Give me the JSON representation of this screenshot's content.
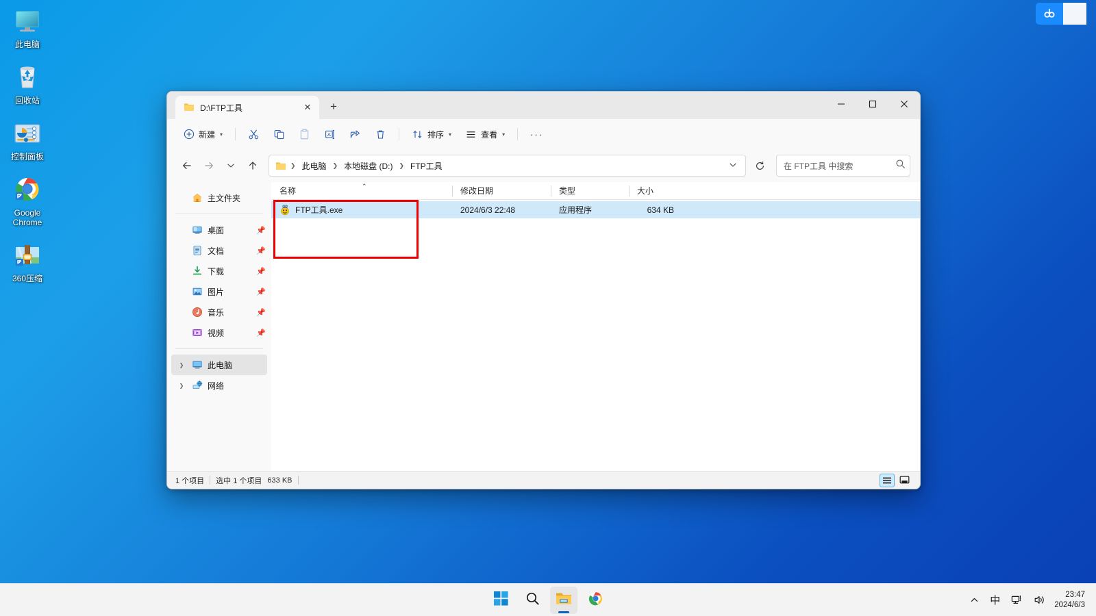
{
  "desktop": {
    "icons": [
      {
        "label": "此电脑",
        "icon": "this-pc-icon"
      },
      {
        "label": "回收站",
        "icon": "recycle-bin-icon"
      },
      {
        "label": "控制面板",
        "icon": "control-panel-icon"
      },
      {
        "label": "Google Chrome",
        "icon": "chrome-icon"
      },
      {
        "label": "360压缩",
        "icon": "360-zip-icon"
      }
    ]
  },
  "netdisk_widget": {
    "icon": "baidu-netdisk-icon",
    "accent": "#1a8cff"
  },
  "explorer": {
    "tab": {
      "title": "D:\\FTP工具",
      "icon": "folder-icon",
      "close_label": "✕"
    },
    "new_tab_label": "+",
    "window_controls": {
      "minimize": "—",
      "maximize": "▢",
      "close": "✕"
    },
    "toolbar": {
      "new_label": "新建",
      "cut_label": "剪切",
      "copy_label": "复制",
      "paste_label": "粘贴",
      "rename_label": "重命名",
      "share_label": "共享",
      "delete_label": "删除",
      "sort_label": "排序",
      "view_label": "查看",
      "more_label": "···"
    },
    "address": {
      "back": "←",
      "forward": "→",
      "recent": "⌄",
      "up": "↑",
      "crumbs": [
        "此电脑",
        "本地磁盘 (D:)",
        "FTP工具"
      ],
      "dropdown": "⌄",
      "refresh_label": "刷新"
    },
    "search": {
      "placeholder": "在 FTP工具 中搜索",
      "icon": "search-icon"
    },
    "navpane": {
      "home": {
        "label": "主文件夹",
        "icon": "home-icon"
      },
      "quick_items": [
        {
          "label": "桌面",
          "icon": "desktop-icon",
          "pinned": true
        },
        {
          "label": "文档",
          "icon": "documents-icon",
          "pinned": true
        },
        {
          "label": "下载",
          "icon": "downloads-icon",
          "pinned": true
        },
        {
          "label": "图片",
          "icon": "pictures-icon",
          "pinned": true
        },
        {
          "label": "音乐",
          "icon": "music-icon",
          "pinned": true
        },
        {
          "label": "视频",
          "icon": "videos-icon",
          "pinned": true
        }
      ],
      "tree_items": [
        {
          "label": "此电脑",
          "icon": "this-pc-icon",
          "selected": true
        },
        {
          "label": "网络",
          "icon": "network-icon",
          "selected": false
        }
      ]
    },
    "columns": [
      {
        "label": "名称",
        "sorted": true,
        "sort_dir": "asc"
      },
      {
        "label": "修改日期",
        "sorted": false
      },
      {
        "label": "类型",
        "sorted": false
      },
      {
        "label": "大小",
        "sorted": false
      }
    ],
    "files": [
      {
        "name": "FTP工具.exe",
        "date": "2024/6/3 22:48",
        "type": "应用程序",
        "size": "634 KB",
        "icon": "ftp-tool-exe-icon",
        "selected": true
      }
    ],
    "statusbar": {
      "count": "1 个项目",
      "selection": "选中 1 个项目",
      "selection_size": "633 KB",
      "details_view": "详细信息视图",
      "large_icons_view": "大图标视图"
    }
  },
  "taskbar": {
    "apps": [
      {
        "name": "start-button",
        "icon": "windows-logo-icon",
        "running": false
      },
      {
        "name": "search-button",
        "icon": "search-icon",
        "running": false
      },
      {
        "name": "file-explorer-button",
        "icon": "folder-icon",
        "running": true
      },
      {
        "name": "chrome-button",
        "icon": "chrome-icon",
        "running": false
      }
    ],
    "tray": {
      "overflow": "⌃",
      "ime": "中",
      "network": "network-icon",
      "volume": "volume-icon",
      "time": "23:47",
      "date": "2024/6/3"
    }
  }
}
